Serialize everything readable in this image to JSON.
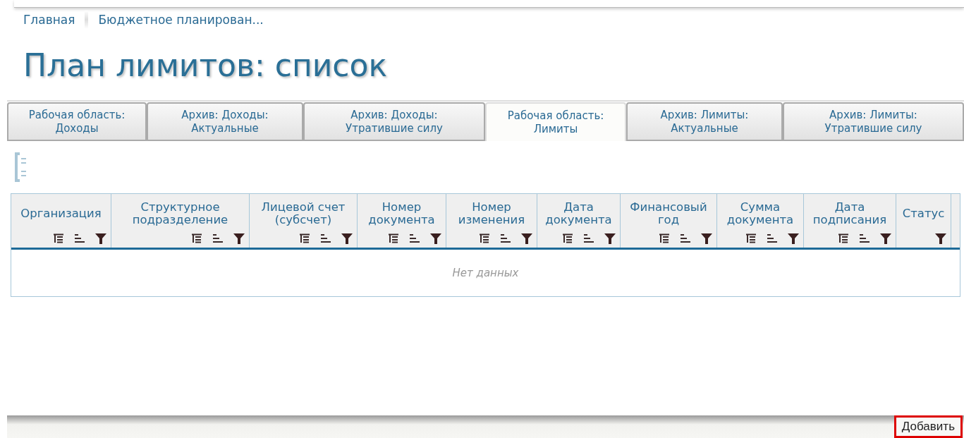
{
  "breadcrumbs": [
    {
      "label": "Главная"
    },
    {
      "label": "Бюджетное планирован..."
    }
  ],
  "title": "План лимитов: список",
  "tabs": [
    {
      "lines": [
        "Рабочая область:",
        "Доходы"
      ],
      "selected": false
    },
    {
      "lines": [
        "Архив: Доходы:",
        "Актуальные"
      ],
      "selected": false
    },
    {
      "lines": [
        "Архив: Доходы:",
        "Утратившие силу"
      ],
      "selected": false
    },
    {
      "lines": [
        "Рабочая область:",
        "Лимиты"
      ],
      "selected": true
    },
    {
      "lines": [
        "Архив: Лимиты:",
        "Актуальные"
      ],
      "selected": false
    },
    {
      "lines": [
        "Архив: Лимиты:",
        "Утратившие силу"
      ],
      "selected": false
    }
  ],
  "table": {
    "columns": [
      {
        "title": "Организация",
        "groupable": true,
        "sortable": true,
        "filterable": true
      },
      {
        "title": "Структурное подразделение",
        "groupable": true,
        "sortable": true,
        "filterable": true
      },
      {
        "title": "Лицевой счет (субсчет)",
        "groupable": true,
        "sortable": true,
        "filterable": true
      },
      {
        "title": "Номер документа",
        "groupable": true,
        "sortable": true,
        "filterable": true
      },
      {
        "title": "Номер изменения",
        "groupable": true,
        "sortable": true,
        "filterable": true
      },
      {
        "title": "Дата документа",
        "groupable": true,
        "sortable": true,
        "filterable": true
      },
      {
        "title": "Финансовый год",
        "groupable": true,
        "sortable": true,
        "filterable": true
      },
      {
        "title": "Сумма документа",
        "groupable": true,
        "sortable": true,
        "filterable": true
      },
      {
        "title": "Дата подписания",
        "groupable": true,
        "sortable": true,
        "filterable": true
      },
      {
        "title": "Статус",
        "groupable": false,
        "sortable": false,
        "filterable": true
      }
    ],
    "empty_message": "Нет данных"
  },
  "footer": {
    "buttons": [
      {
        "label": "Добавить",
        "highlighted": true
      }
    ]
  }
}
